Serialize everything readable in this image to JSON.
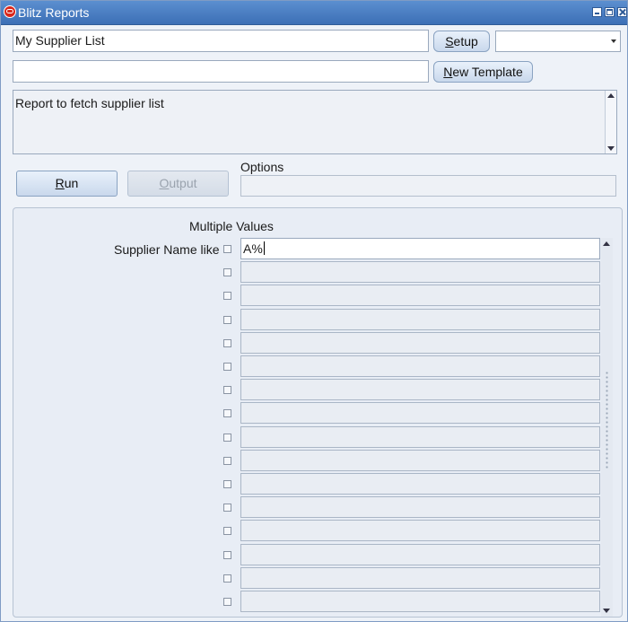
{
  "window": {
    "title": "Blitz Reports"
  },
  "form": {
    "report_name": "My Supplier List",
    "setup_label": "Setup",
    "setup_mnemonic": "S",
    "setup_rest": "etup",
    "template_value": "",
    "template_select": "",
    "new_template_mnemonic": "N",
    "new_template_rest": "ew Template",
    "description": "Report to fetch supplier list"
  },
  "actions": {
    "run_mnemonic": "R",
    "run_rest": "un",
    "output_mnemonic": "O",
    "output_rest": "utput",
    "options_label": "Options",
    "options_value": ""
  },
  "parameters": {
    "multiple_values_header": "Multiple Values",
    "param_label": "Supplier Name like",
    "values": [
      "A%",
      "",
      "",
      "",
      "",
      "",
      "",
      "",
      "",
      "",
      "",
      "",
      "",
      "",
      "",
      ""
    ]
  },
  "icons": [
    "oracle-app-icon",
    "minimize-icon",
    "maximize-icon",
    "close-icon",
    "chevron-down-icon",
    "scroll-up-icon",
    "scroll-down-icon"
  ]
}
